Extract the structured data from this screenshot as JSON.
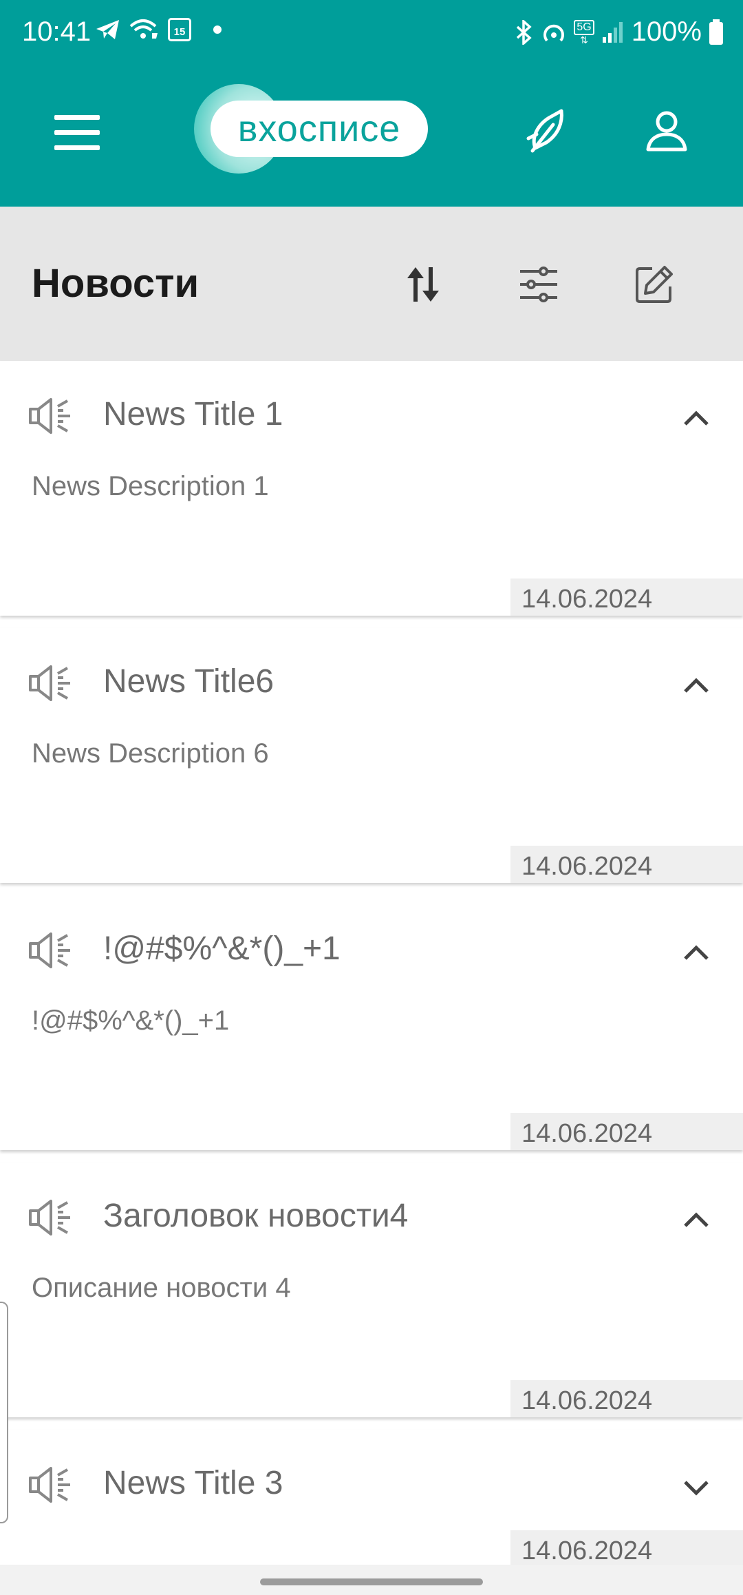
{
  "status_bar": {
    "time": "10:41",
    "calendar_day": "15",
    "network": "5G",
    "battery": "100%"
  },
  "app": {
    "logo_text": "вхосписе",
    "brand_color": "#009e9a"
  },
  "section": {
    "title": "Новости"
  },
  "news": [
    {
      "title": "News Title 1",
      "description": "News Description 1",
      "date": "14.06.2024",
      "expanded": true
    },
    {
      "title": "News Title6",
      "description": "News Description 6",
      "date": "14.06.2024",
      "expanded": true
    },
    {
      "title": "!@#$%^&*()_+1",
      "description": "!@#$%^&*()_+1",
      "date": "14.06.2024",
      "expanded": true
    },
    {
      "title": "Заголовок новости4",
      "description": "Описание новости 4",
      "date": "14.06.2024",
      "expanded": true
    },
    {
      "title": "News Title 3",
      "description": "",
      "date": "14.06.2024",
      "expanded": false
    }
  ],
  "icons": {
    "menu": "hamburger-menu-icon",
    "feather": "feather-icon",
    "profile": "person-icon",
    "sort": "sort-arrows-icon",
    "filter": "sliders-icon",
    "edit": "edit-icon",
    "item": "speaker-icon",
    "collapse": "chevron-up-icon",
    "expand": "chevron-down-icon"
  }
}
